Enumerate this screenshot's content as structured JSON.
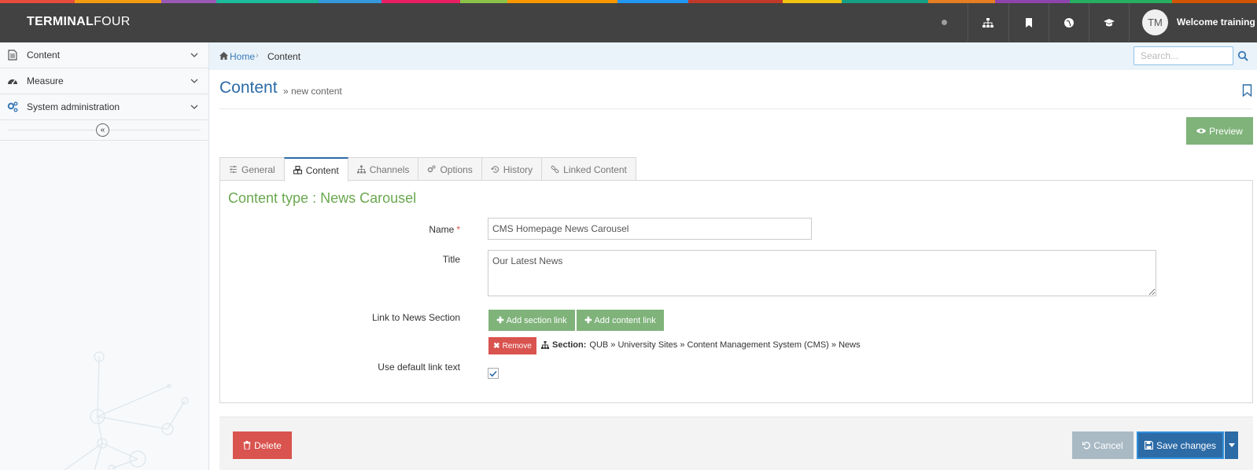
{
  "header": {
    "brand_bold": "TERMINAL",
    "brand_light": "FOUR",
    "user_initials": "TM",
    "welcome_text": "Welcome training",
    "color_strip": [
      "#e74c3c",
      "#f39c12",
      "#9b59b6",
      "#1abc9c",
      "#3498db",
      "#e91e63",
      "#8bc34a",
      "#ff9800",
      "#2196f3",
      "#c0392b",
      "#f1c40f",
      "#16a085",
      "#e67e22",
      "#8e44ad",
      "#27ae60",
      "#d35400"
    ]
  },
  "sidebar": {
    "items": [
      {
        "label": "Content"
      },
      {
        "label": "Measure"
      },
      {
        "label": "System administration"
      }
    ],
    "collapse_glyph": "«"
  },
  "breadcrumb": {
    "home": "Home",
    "separator": "›",
    "current": "Content"
  },
  "search": {
    "placeholder": "Search...",
    "value": ""
  },
  "page": {
    "title": "Content",
    "subtitle": "» new content",
    "preview_label": "Preview"
  },
  "tabs": [
    {
      "label": "General",
      "icon": "sliders-icon"
    },
    {
      "label": "Content",
      "icon": "cubes-icon",
      "active": true
    },
    {
      "label": "Channels",
      "icon": "sitemap-icon"
    },
    {
      "label": "Options",
      "icon": "cogs-icon"
    },
    {
      "label": "History",
      "icon": "history-icon"
    },
    {
      "label": "Linked Content",
      "icon": "link-icon"
    }
  ],
  "form": {
    "content_type": "Content type : News Carousel",
    "name_label": "Name",
    "required_mark": "*",
    "name_value": "CMS Homepage News Carousel",
    "title_label": "Title",
    "title_value": "Our Latest News",
    "link_label": "Link to News Section",
    "add_section_label": "Add section link",
    "add_content_label": "Add content link",
    "remove_label": "Remove",
    "section_prefix": "Section:",
    "section_path": "QUB » University Sites » Content Management System (CMS) » News",
    "default_link_label": "Use default link text",
    "default_link_checked": true
  },
  "footer": {
    "delete_label": "Delete",
    "cancel_label": "Cancel",
    "save_label": "Save changes"
  }
}
